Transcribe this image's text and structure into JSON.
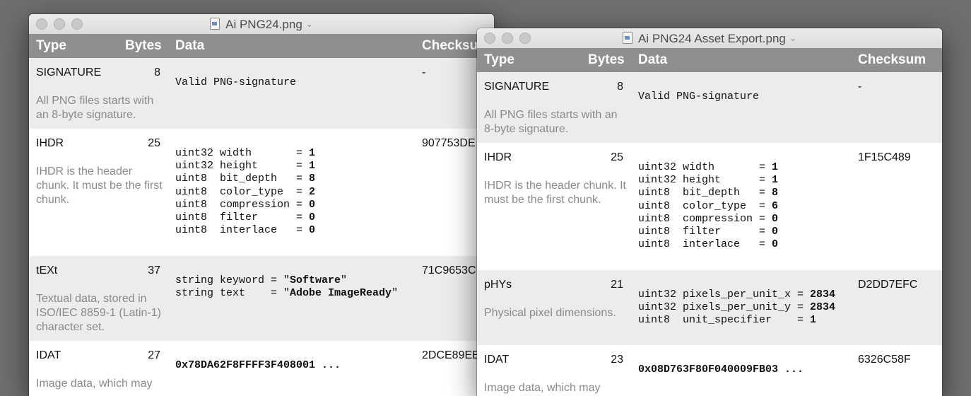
{
  "columns": {
    "type": "Type",
    "bytes": "Bytes",
    "data": "Data",
    "checksum": "Checksum"
  },
  "window1": {
    "title": "Ai PNG24.png",
    "checksum_header": "Checksu",
    "rows": [
      {
        "name": "SIGNATURE",
        "bytes": "8",
        "desc": "All PNG files starts with an 8-byte signature.",
        "checksum": "-",
        "data": [
          [
            {
              "t": "Valid PNG-signature",
              "b": false
            }
          ]
        ]
      },
      {
        "name": "IHDR",
        "bytes": "25",
        "desc": "IHDR is the header chunk. It must be the first chunk.",
        "checksum": "907753DE",
        "data": [
          [
            {
              "t": "uint32 width       = ",
              "b": false
            },
            {
              "t": "1",
              "b": true
            }
          ],
          [
            {
              "t": "uint32 height      = ",
              "b": false
            },
            {
              "t": "1",
              "b": true
            }
          ],
          [
            {
              "t": "uint8  bit_depth   = ",
              "b": false
            },
            {
              "t": "8",
              "b": true
            }
          ],
          [
            {
              "t": "uint8  color_type  = ",
              "b": false
            },
            {
              "t": "2",
              "b": true
            }
          ],
          [
            {
              "t": "uint8  compression = ",
              "b": false
            },
            {
              "t": "0",
              "b": true
            }
          ],
          [
            {
              "t": "uint8  filter      = ",
              "b": false
            },
            {
              "t": "0",
              "b": true
            }
          ],
          [
            {
              "t": "uint8  interlace   = ",
              "b": false
            },
            {
              "t": "0",
              "b": true
            }
          ]
        ]
      },
      {
        "name": "tEXt",
        "bytes": "37",
        "desc": "Textual data, stored in ISO/IEC 8859-1 (Latin-1) character set.",
        "checksum": "71C9653C",
        "data": [
          [
            {
              "t": "string keyword = \"",
              "b": false
            },
            {
              "t": "Software",
              "b": true
            },
            {
              "t": "\"",
              "b": false
            }
          ],
          [
            {
              "t": "string text    = \"",
              "b": false
            },
            {
              "t": "Adobe ImageReady",
              "b": true
            },
            {
              "t": "\"",
              "b": false
            }
          ]
        ]
      },
      {
        "name": "IDAT",
        "bytes": "27",
        "desc": "Image data, which may",
        "checksum": "2DCE89EE",
        "data": [
          [
            {
              "t": "0x78DA62F8FFFF3F408001 ...",
              "b": true
            }
          ]
        ]
      }
    ]
  },
  "window2": {
    "title": "Ai PNG24 Asset Export.png",
    "checksum_header": "Checksum",
    "rows": [
      {
        "name": "SIGNATURE",
        "bytes": "8",
        "desc": "All PNG files starts with an 8-byte signature.",
        "checksum": "-",
        "data": [
          [
            {
              "t": "Valid PNG-signature",
              "b": false
            }
          ]
        ]
      },
      {
        "name": "IHDR",
        "bytes": "25",
        "desc": "IHDR is the header chunk. It must be the first chunk.",
        "checksum": "1F15C489",
        "data": [
          [
            {
              "t": "uint32 width       = ",
              "b": false
            },
            {
              "t": "1",
              "b": true
            }
          ],
          [
            {
              "t": "uint32 height      = ",
              "b": false
            },
            {
              "t": "1",
              "b": true
            }
          ],
          [
            {
              "t": "uint8  bit_depth   = ",
              "b": false
            },
            {
              "t": "8",
              "b": true
            }
          ],
          [
            {
              "t": "uint8  color_type  = ",
              "b": false
            },
            {
              "t": "6",
              "b": true
            }
          ],
          [
            {
              "t": "uint8  compression = ",
              "b": false
            },
            {
              "t": "0",
              "b": true
            }
          ],
          [
            {
              "t": "uint8  filter      = ",
              "b": false
            },
            {
              "t": "0",
              "b": true
            }
          ],
          [
            {
              "t": "uint8  interlace   = ",
              "b": false
            },
            {
              "t": "0",
              "b": true
            }
          ]
        ]
      },
      {
        "name": "pHYs",
        "bytes": "21",
        "desc": "Physical pixel dimensions.",
        "checksum": "D2DD7EFC",
        "data": [
          [
            {
              "t": "uint32 pixels_per_unit_x = ",
              "b": false
            },
            {
              "t": "2834",
              "b": true
            }
          ],
          [
            {
              "t": "uint32 pixels_per_unit_y = ",
              "b": false
            },
            {
              "t": "2834",
              "b": true
            }
          ],
          [
            {
              "t": "uint8  unit_specifier    = ",
              "b": false
            },
            {
              "t": "1",
              "b": true
            }
          ]
        ]
      },
      {
        "name": "IDAT",
        "bytes": "23",
        "desc": "Image data, which may",
        "checksum": "6326C58F",
        "data": [
          [
            {
              "t": "0x08D763F80F040009FB03 ...",
              "b": true
            }
          ]
        ]
      }
    ]
  }
}
